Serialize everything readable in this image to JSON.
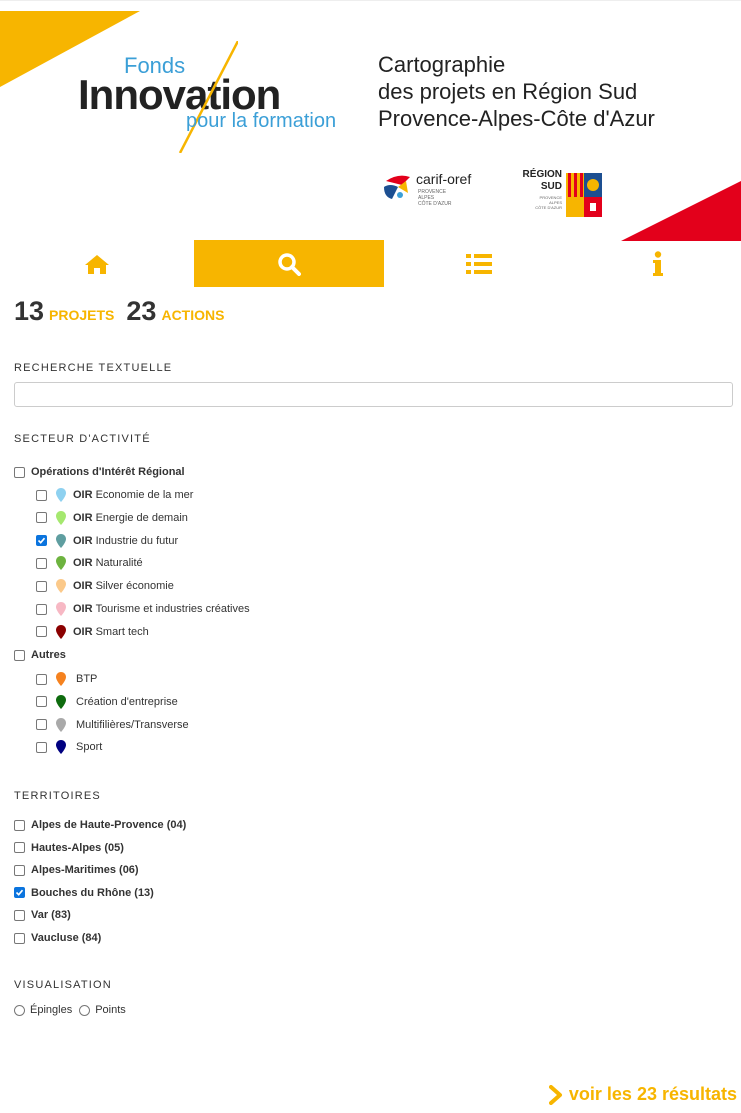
{
  "header": {
    "logo": {
      "top": "Fonds",
      "main": "Innovation",
      "bottom": "pour la formation"
    },
    "title_lines": [
      "Cartographie",
      "des projets en Région Sud",
      "Provence-Alpes-Côte d'Azur"
    ],
    "partner1": {
      "name": "carif-oref",
      "sub": [
        "PROVENCE",
        "ALPES",
        "CÔTE D'AZUR"
      ]
    },
    "partner2": {
      "name": [
        "RÉGION",
        "SUD"
      ],
      "sub": [
        "PROVENCE",
        "ALPES",
        "CÔTE D'AZUR"
      ]
    }
  },
  "nav": {
    "items": [
      {
        "icon": "home-icon"
      },
      {
        "icon": "search-icon",
        "active": true
      },
      {
        "icon": "list-icon"
      },
      {
        "icon": "info-icon"
      }
    ]
  },
  "counts": {
    "projects_num": "13",
    "projects_label": "PROJETS",
    "actions_num": "23",
    "actions_label": "ACTIONS"
  },
  "search": {
    "title": "RECHERCHE TEXTUELLE",
    "value": "",
    "placeholder": ""
  },
  "sector": {
    "title": "SECTEUR D'ACTIVITÉ",
    "group1": {
      "label": "Opérations d'Intérêt Régional",
      "items": [
        {
          "prefix": "OIR",
          "label": "Economie de la mer",
          "color": "#8ed1f0",
          "checked": false
        },
        {
          "prefix": "OIR",
          "label": "Energie de demain",
          "color": "#a5e86f",
          "checked": false
        },
        {
          "prefix": "OIR",
          "label": "Industrie du futur",
          "color": "#5f9ea0",
          "checked": true
        },
        {
          "prefix": "OIR",
          "label": "Naturalité",
          "color": "#6db33f",
          "checked": false
        },
        {
          "prefix": "OIR",
          "label": "Silver économie",
          "color": "#fbc98a",
          "checked": false
        },
        {
          "prefix": "OIR",
          "label": "Tourisme et industries créatives",
          "color": "#f7b8c4",
          "checked": false
        },
        {
          "prefix": "OIR",
          "label": "Smart tech",
          "color": "#8b0000",
          "checked": false
        }
      ]
    },
    "group2": {
      "label": "Autres",
      "items": [
        {
          "label": "BTP",
          "color": "#f5821f",
          "checked": false
        },
        {
          "label": "Création d'entreprise",
          "color": "#0e6b0e",
          "checked": false
        },
        {
          "label": "Multifilières/Transverse",
          "color": "#a9a9a9",
          "checked": false
        },
        {
          "label": "Sport",
          "color": "#000080",
          "checked": false
        }
      ]
    }
  },
  "territories": {
    "title": "TERRITOIRES",
    "items": [
      {
        "label": "Alpes de Haute-Provence (04)",
        "checked": false
      },
      {
        "label": "Hautes-Alpes (05)",
        "checked": false
      },
      {
        "label": "Alpes-Maritimes (06)",
        "checked": false
      },
      {
        "label": "Bouches du Rhône (13)",
        "checked": true
      },
      {
        "label": "Var (83)",
        "checked": false
      },
      {
        "label": "Vaucluse (84)",
        "checked": false
      }
    ]
  },
  "visualisation": {
    "title": "VISUALISATION",
    "options": [
      "Épingles",
      "Points"
    ]
  },
  "results": {
    "label": "voir les 23 résultats"
  },
  "colors": {
    "accent": "#f7b500",
    "red": "#e3001b",
    "check": "#0b74de"
  }
}
